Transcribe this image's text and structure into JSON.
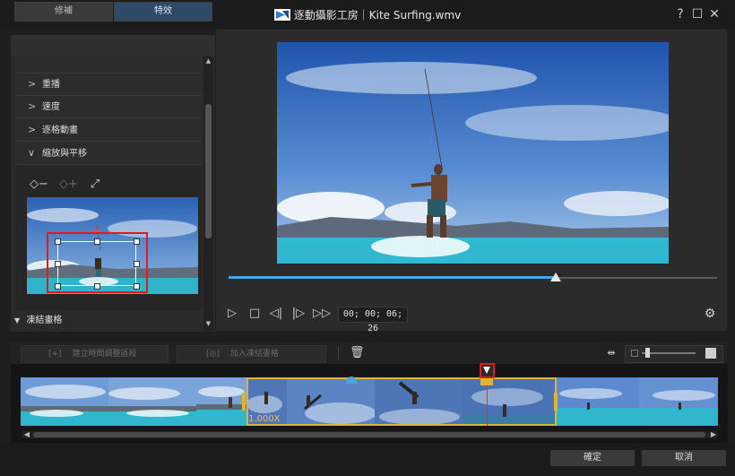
{
  "window": {
    "title": "逐動攝影工房｜Kite Surfing.wmv",
    "controls": {
      "help": "?",
      "maximize": "☐",
      "close": "✕"
    }
  },
  "left_panel": {
    "tabs": [
      {
        "label": "修補",
        "active": false
      },
      {
        "label": "特效",
        "active": true
      }
    ],
    "menu_items": [
      {
        "label": "重播",
        "expanded": false
      },
      {
        "label": "速度",
        "expanded": false
      },
      {
        "label": "逐格動畫",
        "expanded": false
      },
      {
        "label": "縮放與平移",
        "expanded": true
      }
    ],
    "zoom_tools": [
      "remove-keyframe-icon",
      "add-keyframe-icon",
      "fullscreen-frame-icon"
    ],
    "freeze_frame_label": "凍結畫格"
  },
  "player": {
    "timecode": "00; 00; 06; 26",
    "progress": 0.67,
    "controls": [
      "play",
      "stop",
      "previous-frame",
      "next-frame",
      "fast-forward"
    ]
  },
  "timeline_toolbar": {
    "create_range_label": "建立時間調整區段",
    "add_freeze_label": "加入凍結畫格",
    "zoom_level": 0.1
  },
  "timeline": {
    "speed_label": "1.000X",
    "selected_range_color": "#e0b331",
    "playhead_color": "#e03030"
  },
  "footer": {
    "ok_label": "確定",
    "cancel_label": "取消"
  },
  "colors": {
    "accent_blue": "#3fa9e8",
    "highlight_red": "#e01b1b"
  }
}
